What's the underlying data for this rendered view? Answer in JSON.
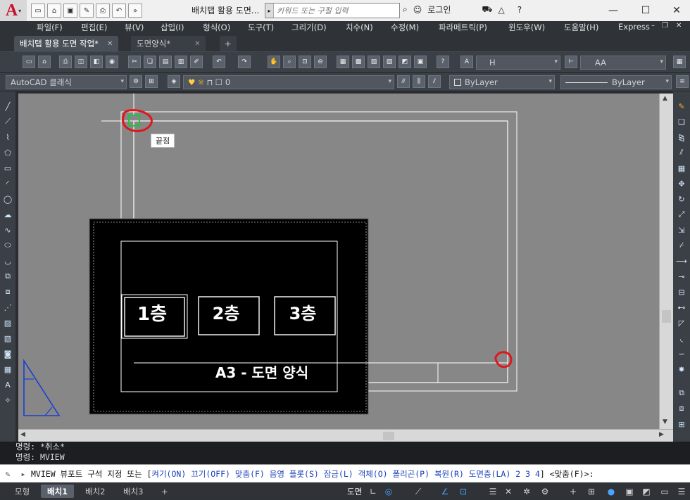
{
  "app": {
    "logo_letter": "A",
    "document_title": "배치탭 활용 도면...",
    "search_placeholder": "키워드 또는 구절 입력",
    "login_label": "로그인"
  },
  "menu": {
    "items": [
      "파일(F)",
      "편집(E)",
      "뷰(V)",
      "삽입(I)",
      "형식(O)",
      "도구(T)",
      "그리기(D)",
      "치수(N)",
      "수정(M)",
      "파라메트릭(P)",
      "윈도우(W)",
      "도움말(H)",
      "Express"
    ]
  },
  "doc_tabs": [
    {
      "label": "배치탭 활용 도면 작업*",
      "active": true
    },
    {
      "label": "도면양식*",
      "active": false
    }
  ],
  "toolbar": {
    "text_style": "H",
    "dim_style": "AA",
    "workspace": "AutoCAD 클래식",
    "layer": "0",
    "color": "ByLayer",
    "linetype": "ByLayer"
  },
  "drawing": {
    "tooltip": "끝점",
    "floors": [
      "1층",
      "2층",
      "3층"
    ],
    "title_block": "A3 - 도면 양식",
    "accent_color": "#e0161b",
    "snap_color": "#22c33a"
  },
  "command": {
    "history": [
      "명령: *취소*",
      "명령: MVIEW"
    ],
    "prompt_prefix": "MVIEW 뷰포트 구석 지정 또는 [",
    "options": [
      "켜기(ON)",
      "끄기(OFF)",
      "맞춤(F)",
      "음영 플롯(S)",
      "잠금(L)",
      "객체(O)",
      "폴리곤(P)",
      "복원(R)",
      "도면층(LA)",
      "2",
      "3",
      "4"
    ],
    "prompt_suffix": "] <맞춤(F)>:"
  },
  "status": {
    "tabs": [
      {
        "label": "모형",
        "active": false
      },
      {
        "label": "배치1",
        "active": true
      },
      {
        "label": "배치2",
        "active": false
      },
      {
        "label": "배치3",
        "active": false
      }
    ],
    "paper_label": "도면"
  }
}
